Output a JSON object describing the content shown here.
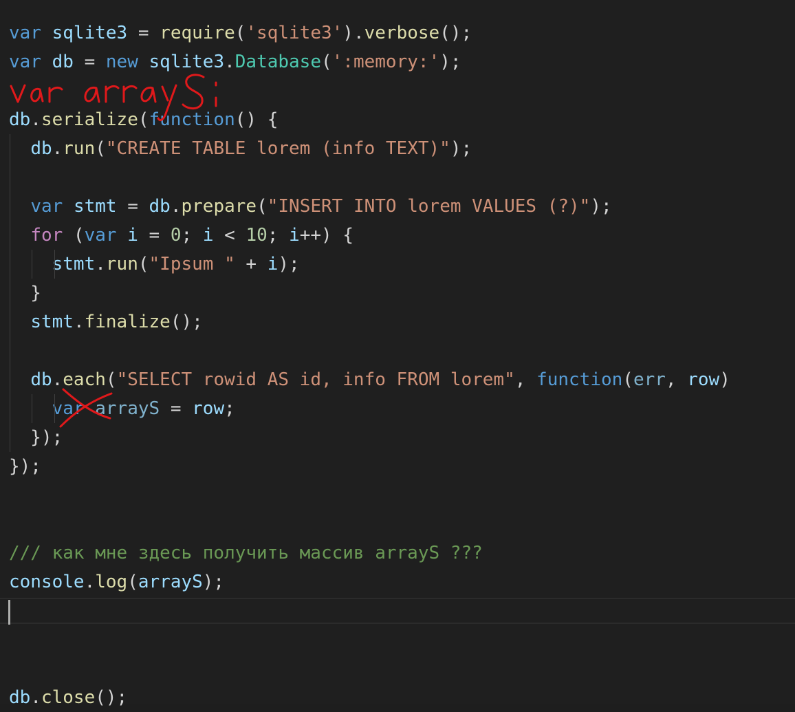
{
  "editor": {
    "lines": [
      [
        [
          "kw",
          "var"
        ],
        [
          "p",
          " "
        ],
        [
          "var",
          "sqlite3"
        ],
        [
          "p",
          " = "
        ],
        [
          "fn",
          "require"
        ],
        [
          "p",
          "("
        ],
        [
          "str",
          "'sqlite3'"
        ],
        [
          "p",
          ")."
        ],
        [
          "fn",
          "verbose"
        ],
        [
          "p",
          "();"
        ]
      ],
      [
        [
          "kw",
          "var"
        ],
        [
          "p",
          " "
        ],
        [
          "var",
          "db"
        ],
        [
          "p",
          " = "
        ],
        [
          "kw",
          "new"
        ],
        [
          "p",
          " "
        ],
        [
          "var",
          "sqlite3"
        ],
        [
          "p",
          "."
        ],
        [
          "cls",
          "Database"
        ],
        [
          "p",
          "("
        ],
        [
          "str",
          "':memory:'"
        ],
        [
          "p",
          ");"
        ]
      ],
      [],
      [
        [
          "var",
          "db"
        ],
        [
          "p",
          "."
        ],
        [
          "fn",
          "serialize"
        ],
        [
          "p",
          "("
        ],
        [
          "kw",
          "function"
        ],
        [
          "p",
          "() {"
        ]
      ],
      [
        [
          "p",
          "  "
        ],
        [
          "var",
          "db"
        ],
        [
          "p",
          "."
        ],
        [
          "fn",
          "run"
        ],
        [
          "p",
          "("
        ],
        [
          "str",
          "\"CREATE TABLE lorem (info TEXT)\""
        ],
        [
          "p",
          ");"
        ]
      ],
      [],
      [
        [
          "p",
          "  "
        ],
        [
          "kw",
          "var"
        ],
        [
          "p",
          " "
        ],
        [
          "var",
          "stmt"
        ],
        [
          "p",
          " = "
        ],
        [
          "var",
          "db"
        ],
        [
          "p",
          "."
        ],
        [
          "fn",
          "prepare"
        ],
        [
          "p",
          "("
        ],
        [
          "str",
          "\"INSERT INTO lorem VALUES (?)\""
        ],
        [
          "p",
          ");"
        ]
      ],
      [
        [
          "p",
          "  "
        ],
        [
          "ctl",
          "for"
        ],
        [
          "p",
          " ("
        ],
        [
          "kw",
          "var"
        ],
        [
          "p",
          " "
        ],
        [
          "var",
          "i"
        ],
        [
          "p",
          " = "
        ],
        [
          "num",
          "0"
        ],
        [
          "p",
          "; "
        ],
        [
          "var",
          "i"
        ],
        [
          "p",
          " < "
        ],
        [
          "num",
          "10"
        ],
        [
          "p",
          "; "
        ],
        [
          "var",
          "i"
        ],
        [
          "p",
          "++) {"
        ]
      ],
      [
        [
          "p",
          "    "
        ],
        [
          "var",
          "stmt"
        ],
        [
          "p",
          "."
        ],
        [
          "fn",
          "run"
        ],
        [
          "p",
          "("
        ],
        [
          "str",
          "\"Ipsum \""
        ],
        [
          "p",
          " + "
        ],
        [
          "var",
          "i"
        ],
        [
          "p",
          ");"
        ]
      ],
      [
        [
          "p",
          "  }"
        ]
      ],
      [
        [
          "p",
          "  "
        ],
        [
          "var",
          "stmt"
        ],
        [
          "p",
          "."
        ],
        [
          "fn",
          "finalize"
        ],
        [
          "p",
          "();"
        ]
      ],
      [],
      [
        [
          "p",
          "  "
        ],
        [
          "var",
          "db"
        ],
        [
          "p",
          "."
        ],
        [
          "fn",
          "each"
        ],
        [
          "p",
          "("
        ],
        [
          "str",
          "\"SELECT rowid AS id, info FROM lorem\""
        ],
        [
          "p",
          ", "
        ],
        [
          "kw",
          "function"
        ],
        [
          "p",
          "("
        ],
        [
          "dim",
          "err"
        ],
        [
          "p",
          ", "
        ],
        [
          "param",
          "row"
        ],
        [
          "p",
          ")"
        ]
      ],
      [
        [
          "p",
          "    "
        ],
        [
          "kw",
          "var"
        ],
        [
          "p",
          " "
        ],
        [
          "dim",
          "arrayS"
        ],
        [
          "p",
          " = "
        ],
        [
          "var",
          "row"
        ],
        [
          "p",
          ";"
        ]
      ],
      [
        [
          "p",
          "  });"
        ]
      ],
      [
        [
          "p",
          "});"
        ]
      ],
      [],
      [],
      [
        [
          "cmt",
          "/// как мне здесь получить массив arrayS ???"
        ]
      ],
      [
        [
          "var",
          "console"
        ],
        [
          "p",
          "."
        ],
        [
          "fn",
          "log"
        ],
        [
          "p",
          "("
        ],
        [
          "var",
          "arrayS"
        ],
        [
          "p",
          ");"
        ]
      ],
      [],
      [],
      [],
      [
        [
          "var",
          "db"
        ],
        [
          "p",
          "."
        ],
        [
          "fn",
          "close"
        ],
        [
          "p",
          "();"
        ]
      ]
    ]
  },
  "annotation": {
    "handwritten_text": "var arrayS;",
    "color": "#e0191b"
  }
}
